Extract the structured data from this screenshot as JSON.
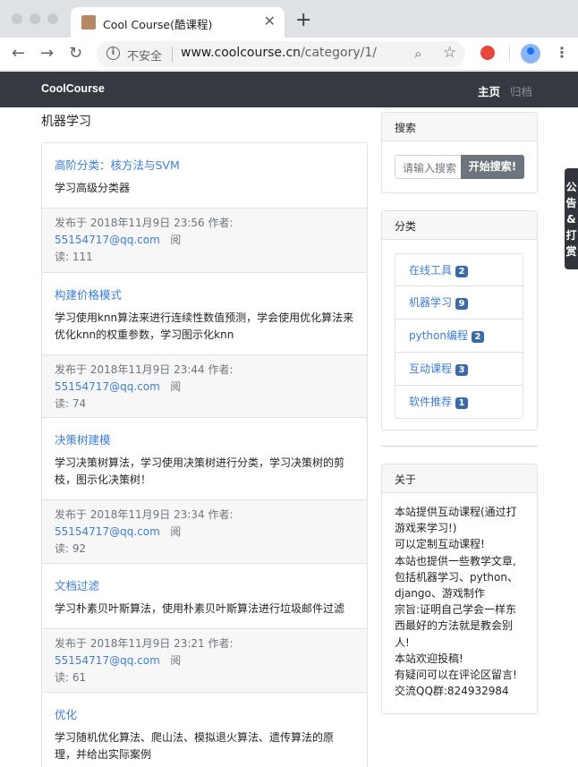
{
  "browser": {
    "tab_title": "Cool Course(酷课程)",
    "tab_close": "✕",
    "new_tab": "+",
    "insecure_label": "不安全",
    "url_host": "www.coolcourse.cn",
    "url_path": "/category/1/"
  },
  "navbar": {
    "brand": "CoolCourse",
    "home": "主页",
    "archive": "归档"
  },
  "main": {
    "category_title": "机器学习",
    "posts": [
      {
        "title": "高阶分类：核方法与SVM",
        "summary": "学习高级分类器",
        "meta_prefix": "发布于 2018年11月9日 23:56 作者: ",
        "author": "55154717@qq.com",
        "read_label": "阅",
        "reads": "读: 111"
      },
      {
        "title": "构建价格模式",
        "summary": "学习使用knn算法来进行连续性数值预测，学会使用优化算法来优化knn的权重参数，学习图示化knn",
        "meta_prefix": "发布于 2018年11月9日 23:44 作者: ",
        "author": "55154717@qq.com",
        "read_label": "阅",
        "reads": "读: 74"
      },
      {
        "title": "决策树建模",
        "summary": "学习决策树算法，学习使用决策树进行分类，学习决策树的剪枝，图示化决策树！",
        "meta_prefix": "发布于 2018年11月9日 23:34 作者: ",
        "author": "55154717@qq.com",
        "read_label": "阅",
        "reads": "读: 92"
      },
      {
        "title": "文档过滤",
        "summary": "学习朴素贝叶斯算法，使用朴素贝叶斯算法进行垃圾邮件过滤",
        "meta_prefix": "发布于 2018年11月9日 23:21 作者: ",
        "author": "55154717@qq.com",
        "read_label": "阅",
        "reads": "读: 61"
      },
      {
        "title": "优化",
        "summary": "学习随机优化算法、爬山法、模拟退火算法、遗传算法的原理，并给出实际案例"
      }
    ]
  },
  "sidebar": {
    "search": {
      "header": "搜索",
      "placeholder": "请输入搜索",
      "button": "开始搜索!"
    },
    "categories": {
      "header": "分类",
      "items": [
        {
          "label": "在线工具",
          "count": "2"
        },
        {
          "label": "机器学习",
          "count": "9"
        },
        {
          "label": "python编程",
          "count": "2"
        },
        {
          "label": "互动课程",
          "count": "3"
        },
        {
          "label": "软件推荐",
          "count": "1"
        }
      ]
    },
    "about": {
      "header": "关于",
      "lines": [
        "本站提供互动课程(通过打",
        "游戏来学习!)",
        "可以定制互动课程!",
        "本站也提供一些教学文章,",
        "包括机器学习、python、",
        "django、游戏制作",
        "宗旨:证明自己学会一样东",
        "西最好的方法就是教会别",
        "人!",
        "本站欢迎投稿!",
        "有疑问可以在评论区留言!",
        "交流QQ群:824932984"
      ]
    }
  },
  "side_tab": {
    "lines": [
      "公",
      "告",
      "&",
      "打",
      "赏"
    ]
  },
  "colors": {
    "navbar_bg": "#343a40",
    "link": "#3b7dd8",
    "badge": "#3b6aa8",
    "search_button": "#6c757d"
  }
}
